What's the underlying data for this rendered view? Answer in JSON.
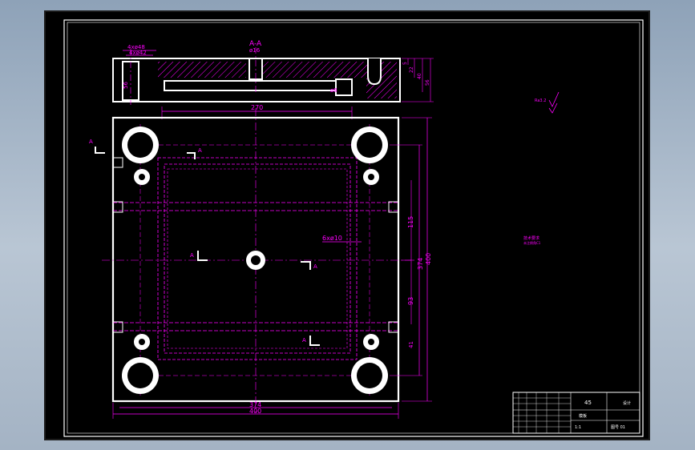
{
  "section": {
    "title": "A-A",
    "dims": {
      "hole_large": "4xø48",
      "hole_small": "4xø42",
      "center_dia": "ø16",
      "slot_dia": "ø8",
      "overall_height": "56",
      "right_dims": [
        "5",
        "22",
        "40",
        "56"
      ]
    }
  },
  "plan": {
    "dims": {
      "top_width": "270",
      "bottom_inner": "374",
      "bottom_outer": "400",
      "right_inner": "374",
      "right_outer": "400",
      "vert_115": "115",
      "vert_93": "93",
      "vert_41": "41"
    },
    "callout": "6xø10",
    "cut_marks": [
      "A",
      "A",
      "A",
      "A",
      "A",
      "A"
    ]
  },
  "notes": {
    "roughness": "Ra3.2",
    "tech_req_1": "技术要求",
    "tech_req_2": "未注倒角C1"
  },
  "title_block": {
    "material": "45",
    "scale": "1:1",
    "designer": "设计",
    "part_name": "模板",
    "drawing_no": "图号 01"
  },
  "colors": {
    "lines": "#ff00ff",
    "outline": "#ffffff",
    "background": "#000000"
  }
}
